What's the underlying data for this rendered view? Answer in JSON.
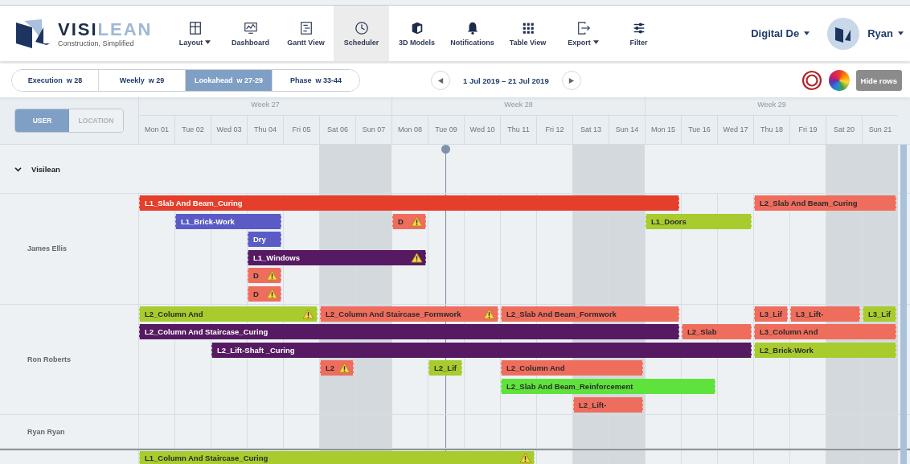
{
  "logo": {
    "name_dark": "VISI",
    "name_light": "LEAN",
    "tagline": "Construction, Simplified"
  },
  "nav": [
    {
      "label": "Layout",
      "dropdown": true,
      "selected": false
    },
    {
      "label": "Dashboard",
      "dropdown": false,
      "selected": false
    },
    {
      "label": "Gantt View",
      "dropdown": false,
      "selected": false
    },
    {
      "label": "Scheduler",
      "dropdown": false,
      "selected": true
    },
    {
      "label": "3D Models",
      "dropdown": false,
      "selected": false
    },
    {
      "label": "Notifications",
      "dropdown": false,
      "selected": false
    },
    {
      "label": "Table View",
      "dropdown": false,
      "selected": false
    },
    {
      "label": "Export",
      "dropdown": true,
      "selected": false
    },
    {
      "label": "Filter",
      "dropdown": false,
      "selected": false
    }
  ],
  "project": {
    "label": "Digital De",
    "dropdown": true
  },
  "user": {
    "label": "Ryan",
    "dropdown": true
  },
  "plan_tabs": [
    {
      "label": "Execution",
      "week": "w 28",
      "selected": false
    },
    {
      "label": "Weekly",
      "week": "w 29",
      "selected": false
    },
    {
      "label": "Lookahead",
      "week": "w 27-29",
      "selected": true
    },
    {
      "label": "Phase",
      "week": "w 33-44",
      "selected": false
    }
  ],
  "date_range": "1 Jul 2019 – 21 Jul 2019",
  "hide_rows_button": "Hide rows",
  "view_toggle": [
    {
      "label": "USER",
      "selected": true
    },
    {
      "label": "LOCATION",
      "selected": false
    }
  ],
  "weeks": [
    {
      "label": "Week 27",
      "days": [
        "Mon 01",
        "Tue 02",
        "Wed 03",
        "Thu 04",
        "Fri 05",
        "Sat 06",
        "Sun 07"
      ]
    },
    {
      "label": "Week 28",
      "days": [
        "Mon 08",
        "Tue 09",
        "Wed 10",
        "Thu 11",
        "Fri 12",
        "Sat 13",
        "Sun 14"
      ]
    },
    {
      "label": "Week 29",
      "days": [
        "Mon 15",
        "Tue 16",
        "Wed 17",
        "Thu 18",
        "Fri 19",
        "Sat 20",
        "Sun 21"
      ]
    }
  ],
  "group": {
    "label": "Visilean",
    "expanded": true
  },
  "resources": [
    {
      "name": "James Ellis",
      "lanes": [
        [
          {
            "label": "L1_Slab And Beam_Curing",
            "color": "#e53e2b",
            "warning": false
          },
          {
            "label": "L2_Slab And Beam_Curing",
            "color": "#ef6d5d",
            "warning": false
          }
        ],
        [
          {
            "label": "L1_Brick-Work",
            "color": "#5b5bc6",
            "warning": false
          },
          {
            "label": "D",
            "color": "#ef6d5d",
            "warning": true
          },
          {
            "label": "L1_Doors",
            "color": "#a8cb2e",
            "warning": false
          }
        ],
        [
          {
            "label": "Dry",
            "color": "#5b5bc6",
            "warning": false
          }
        ],
        [
          {
            "label": "L1_Windows",
            "color": "#561a62",
            "warning": true
          }
        ],
        [
          {
            "label": "D",
            "color": "#ef6d5d",
            "warning": true
          }
        ],
        [
          {
            "label": "D",
            "color": "#ef6d5d",
            "warning": true
          }
        ]
      ]
    },
    {
      "name": "Ron Roberts",
      "lanes": [
        [
          {
            "label": "L2_Column And",
            "color": "#a8cb2e",
            "warning": true
          },
          {
            "label": "L2_Column And Staircase_Formwork",
            "color": "#ef6d5d",
            "warning": true
          },
          {
            "label": "L2_Slab And Beam_Formwork",
            "color": "#ef6d5d",
            "warning": false
          },
          {
            "label": "L3_Lif",
            "color": "#ef6d5d",
            "warning": false
          },
          {
            "label": "L3_Lift-",
            "color": "#ef6d5d",
            "warning": false
          },
          {
            "label": "L3_Lif",
            "color": "#a8cb2e",
            "warning": false
          }
        ],
        [
          {
            "label": "L2_Column And Staircase_Curing",
            "color": "#561a62",
            "warning": false
          },
          {
            "label": "L2_Slab",
            "color": "#ef6d5d",
            "warning": false
          },
          {
            "label": "L3_Column And",
            "color": "#ef6d5d",
            "warning": false
          }
        ],
        [
          {
            "label": "L2_Lift-Shaft _Curing",
            "color": "#561a62",
            "warning": false
          },
          {
            "label": "L2_Brick-Work",
            "color": "#a8cb2e",
            "warning": false
          }
        ],
        [
          {
            "label": "L2",
            "color": "#ef6d5d",
            "warning": true
          },
          {
            "label": "L2_Lif",
            "color": "#a8cb2e",
            "warning": false
          },
          {
            "label": "L2_Column And",
            "color": "#ef6d5d",
            "warning": false
          }
        ],
        [
          {
            "label": "L2_Slab And Beam_Reinforcement",
            "color": "#5fe23c",
            "warning": false
          }
        ],
        [
          {
            "label": "L2_Lift-",
            "color": "#ef6d5d",
            "warning": false
          }
        ]
      ]
    },
    {
      "name": "Ryan Ryan"
    },
    {
      "lanes": [
        [
          {
            "label": "L1_Column And Staircase_Curing",
            "color": "#a8cb2e",
            "warning": true
          }
        ]
      ]
    }
  ]
}
